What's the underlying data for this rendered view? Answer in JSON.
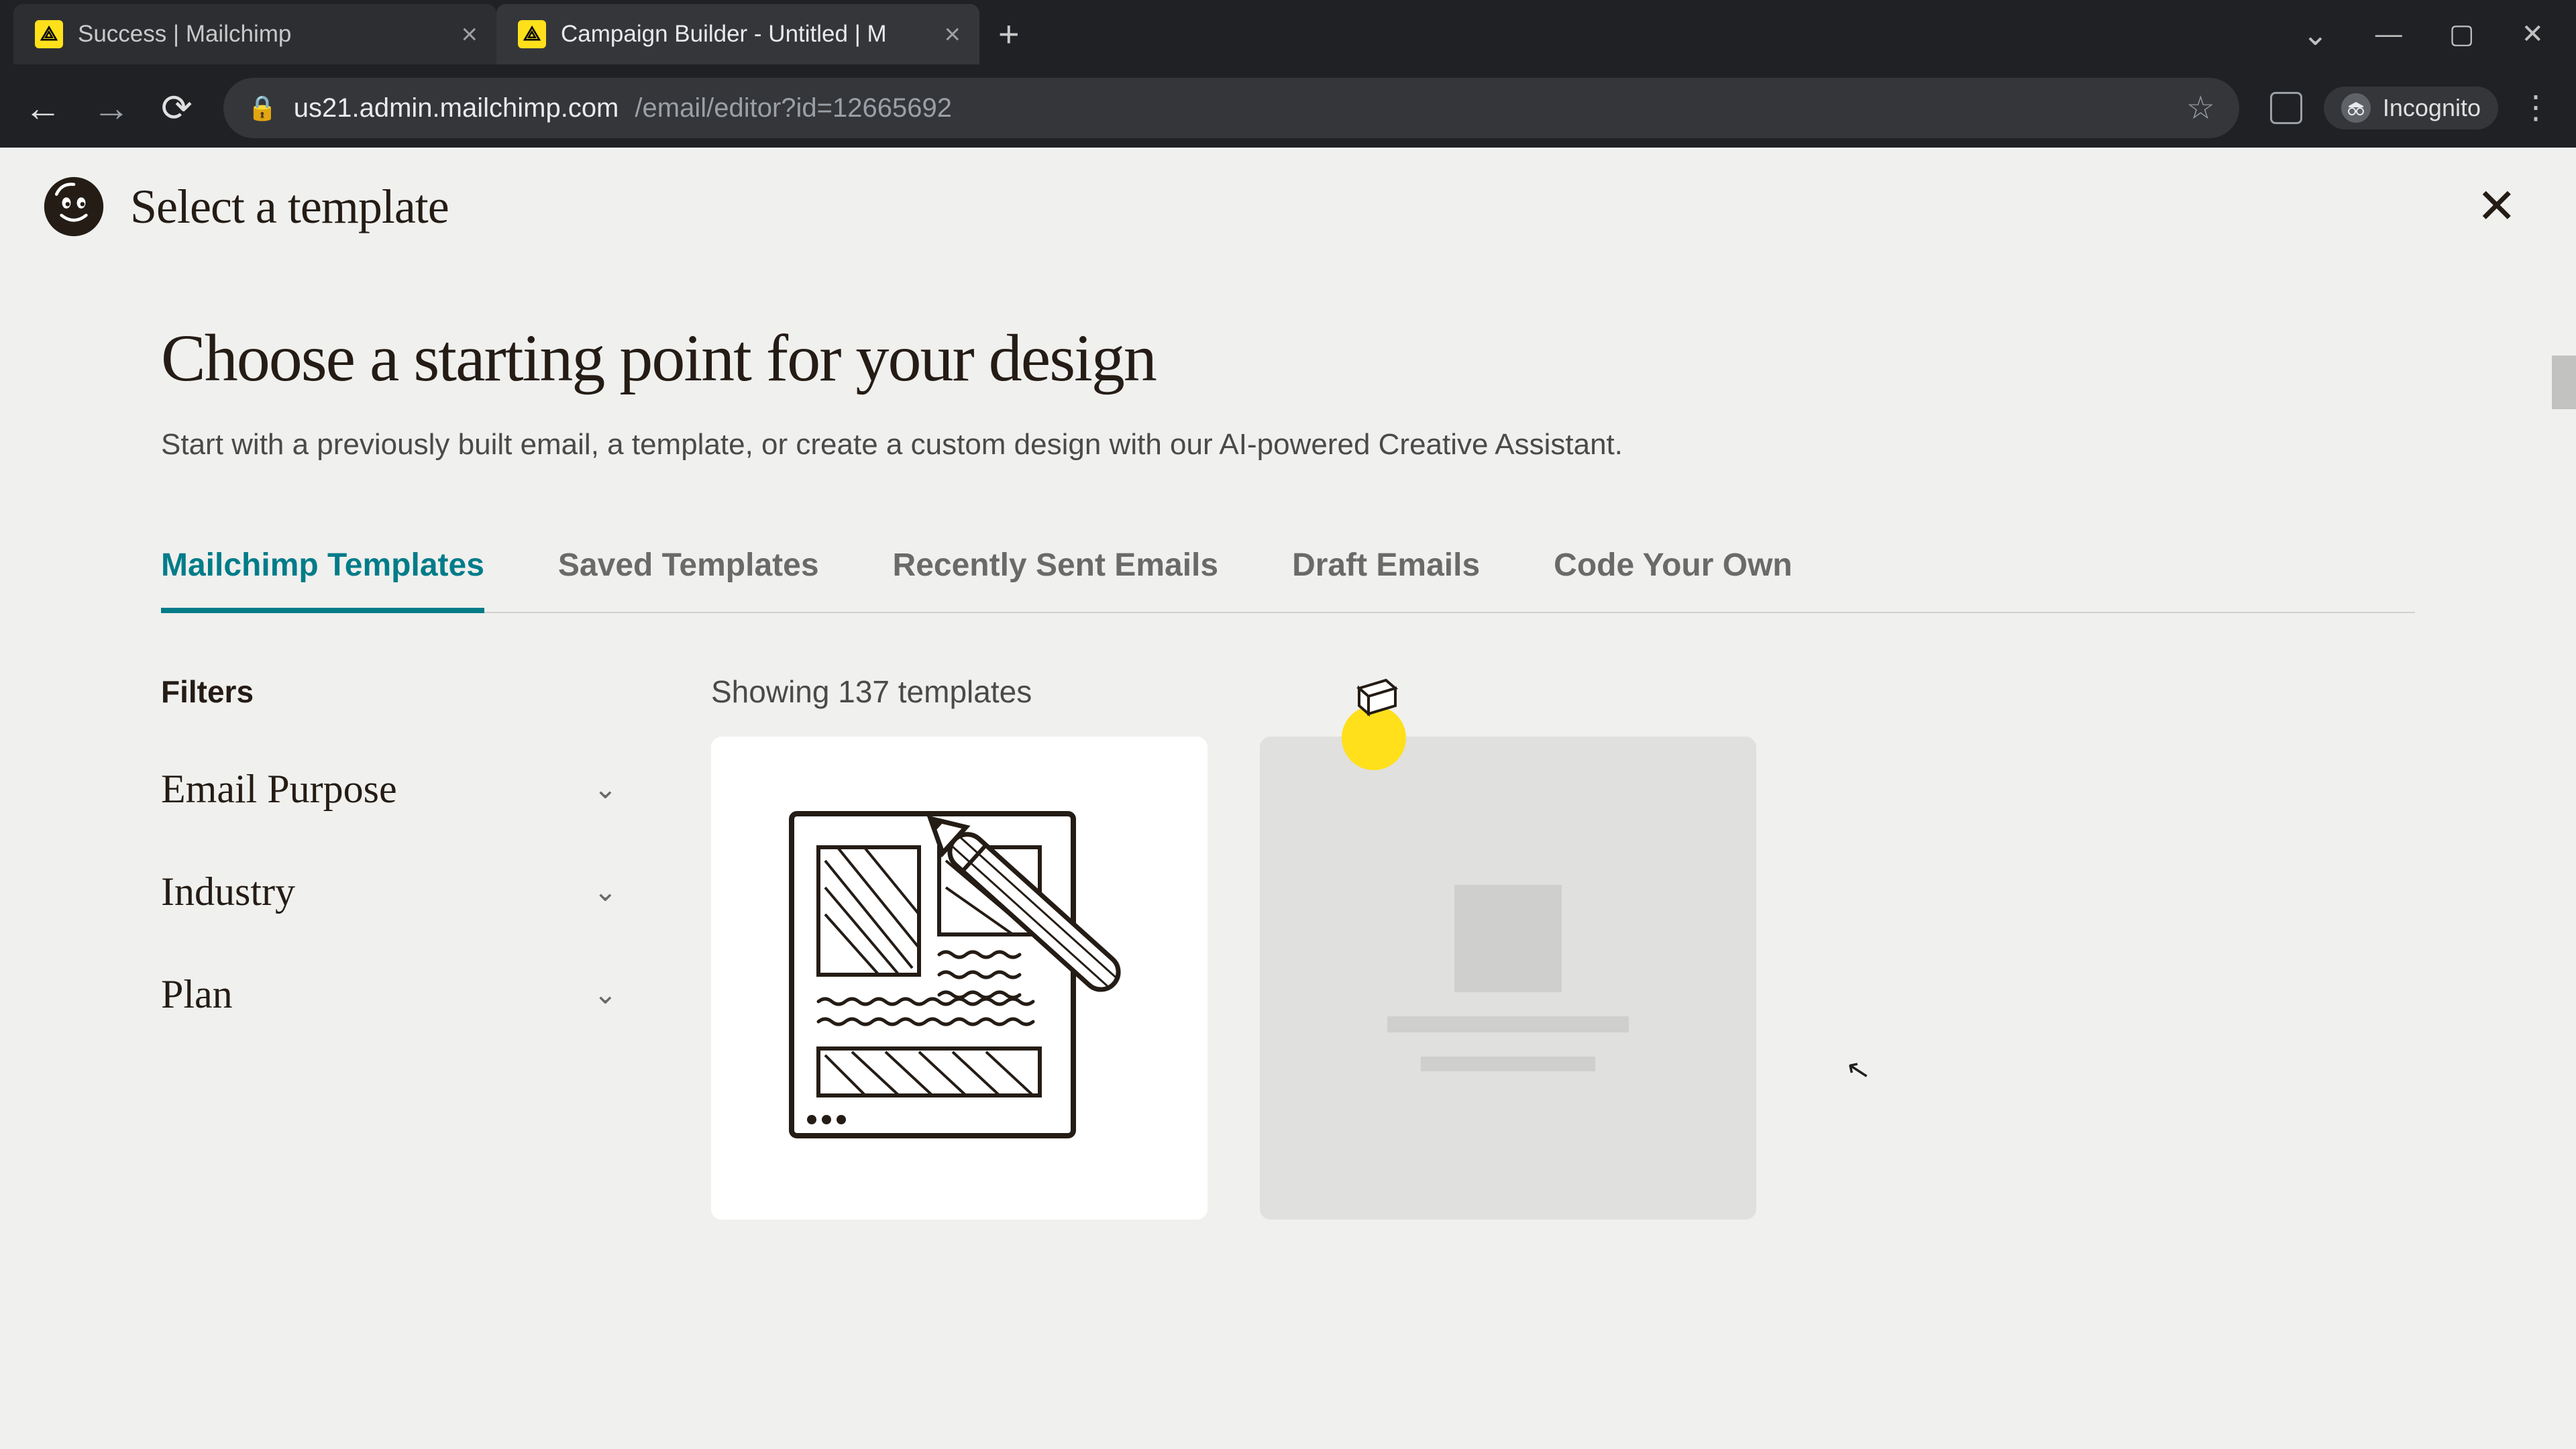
{
  "browser": {
    "tabs": [
      {
        "title": "Success | Mailchimp",
        "active": false
      },
      {
        "title": "Campaign Builder - Untitled | M",
        "active": true
      }
    ],
    "url_host": "us21.admin.mailchimp.com",
    "url_path": "/email/editor?id=12665692",
    "incognito_label": "Incognito"
  },
  "header": {
    "title": "Select a template"
  },
  "main": {
    "headline": "Choose a starting point for your design",
    "subhead": "Start with a previously built email, a template, or create a custom design with our AI-powered Creative Assistant.",
    "tabs": [
      {
        "label": "Mailchimp Templates",
        "selected": true
      },
      {
        "label": "Saved Templates",
        "selected": false
      },
      {
        "label": "Recently Sent Emails",
        "selected": false
      },
      {
        "label": "Draft Emails",
        "selected": false
      },
      {
        "label": "Code Your Own",
        "selected": false
      }
    ],
    "filters": {
      "heading": "Filters",
      "items": [
        {
          "label": "Email Purpose"
        },
        {
          "label": "Industry"
        },
        {
          "label": "Plan"
        }
      ]
    },
    "results_count": "Showing 137 templates"
  }
}
